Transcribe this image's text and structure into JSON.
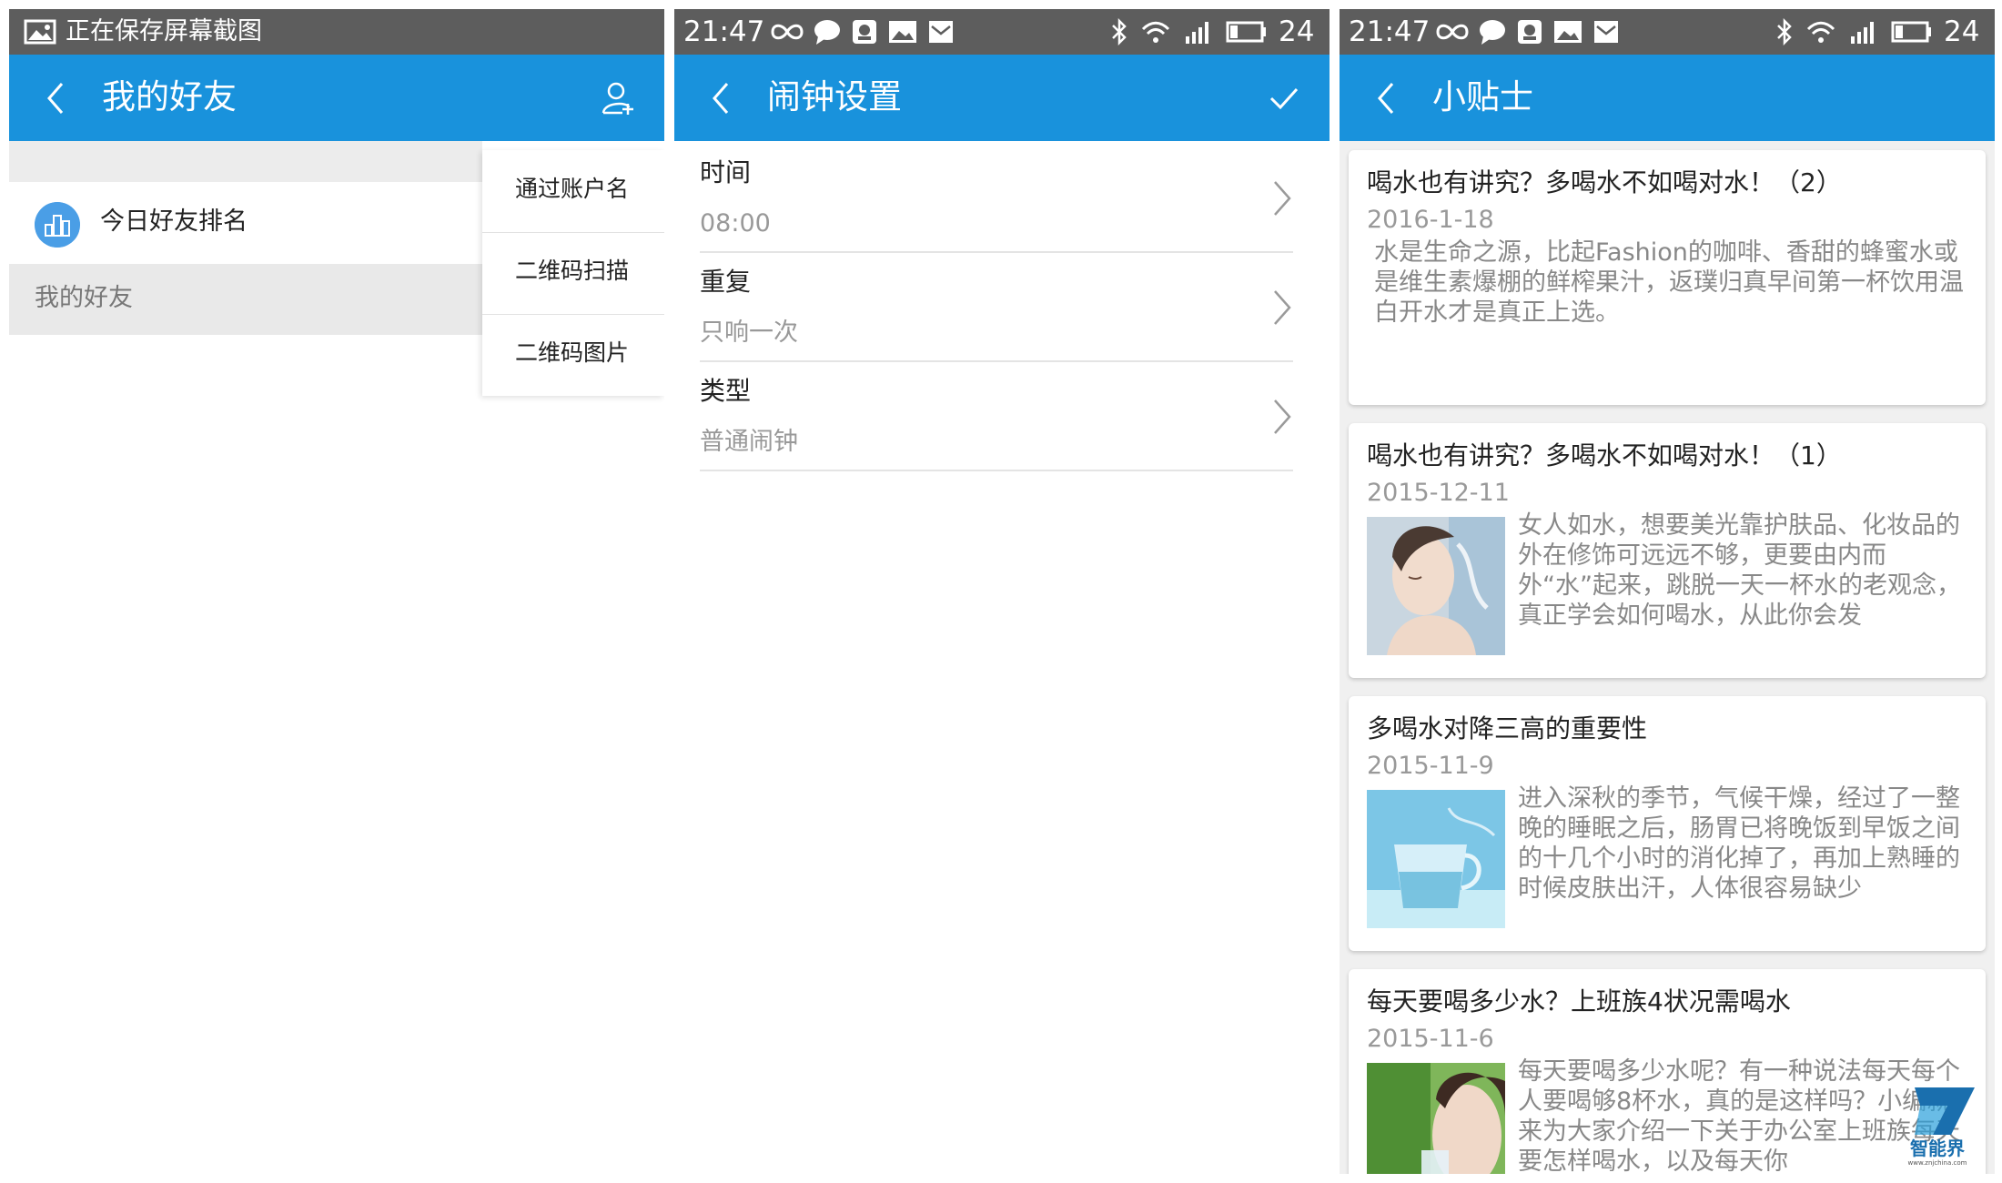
{
  "panel1": {
    "status": {
      "text": "正在保存屏幕截图"
    },
    "titlebar": {
      "title": "我的好友"
    },
    "rank_label": "今日好友排名",
    "section_header": "我的好友",
    "popup_menu": [
      "通过账户名",
      "二维码扫描",
      "二维码图片"
    ]
  },
  "panel2": {
    "status": {
      "time": "21:47",
      "battery": "24"
    },
    "titlebar": {
      "title": "闹钟设置"
    },
    "settings": [
      {
        "label": "时间",
        "value": "08:00"
      },
      {
        "label": "重复",
        "value": "只响一次"
      },
      {
        "label": "类型",
        "value": "普通闹钟"
      }
    ]
  },
  "panel3": {
    "status": {
      "time": "21:47",
      "battery": "24"
    },
    "titlebar": {
      "title": "小贴士"
    },
    "articles": [
      {
        "title": "喝水也有讲究？多喝水不如喝对水！（2）",
        "date": "2016-1-18",
        "body": "水是生命之源，比起Fashion的咖啡、香甜的蜂蜜水或是维生素爆棚的鲜榨果汁，返璞归真早间第一杯饮用温白开水才是真正上选。"
      },
      {
        "title": "喝水也有讲究？多喝水不如喝对水！（1）",
        "date": "2015-12-11",
        "body": "女人如水，想要美光靠护肤品、化妆品的外在修饰可远远不够，更要由内而外“水”起来，跳脱一天一杯水的老观念，真正学会如何喝水，从此你会发现，“水”实"
      },
      {
        "title": "多喝水对降三高的重要性",
        "date": "2015-11-9",
        "body": "进入深秋的季节，气候干燥，经过了一整晚的睡眠之后，肠胃已将晚饭到早饭之间的十几个小时的消化掉了，再加上熟睡的时候皮肤出汗，人体很容易缺少"
      },
      {
        "title": "每天要喝多少水？上班族4状况需喝水",
        "date": "2015-11-6",
        "body": "每天要喝多少水呢？有一种说法每天每个人要喝够8杯水，真的是这样吗？小编就来为大家介绍一下关于办公室上班族每天要怎样喝水，以及每天你"
      }
    ]
  },
  "watermark": {
    "brand": "智能界",
    "url": "www.znjchina.com"
  },
  "colors": {
    "status_bar": "#5d5d5d",
    "title_bar": "#1992dc",
    "secondary_text": "#999999"
  },
  "icons": [
    "image-icon",
    "back-arrow-icon",
    "add-friend-icon",
    "checkmark-icon",
    "chevron-right-icon",
    "ranking-icon",
    "infinity-icon",
    "chat-bubble-icon",
    "bluetooth-icon",
    "wifi-icon",
    "signal-icon",
    "battery-icon"
  ]
}
